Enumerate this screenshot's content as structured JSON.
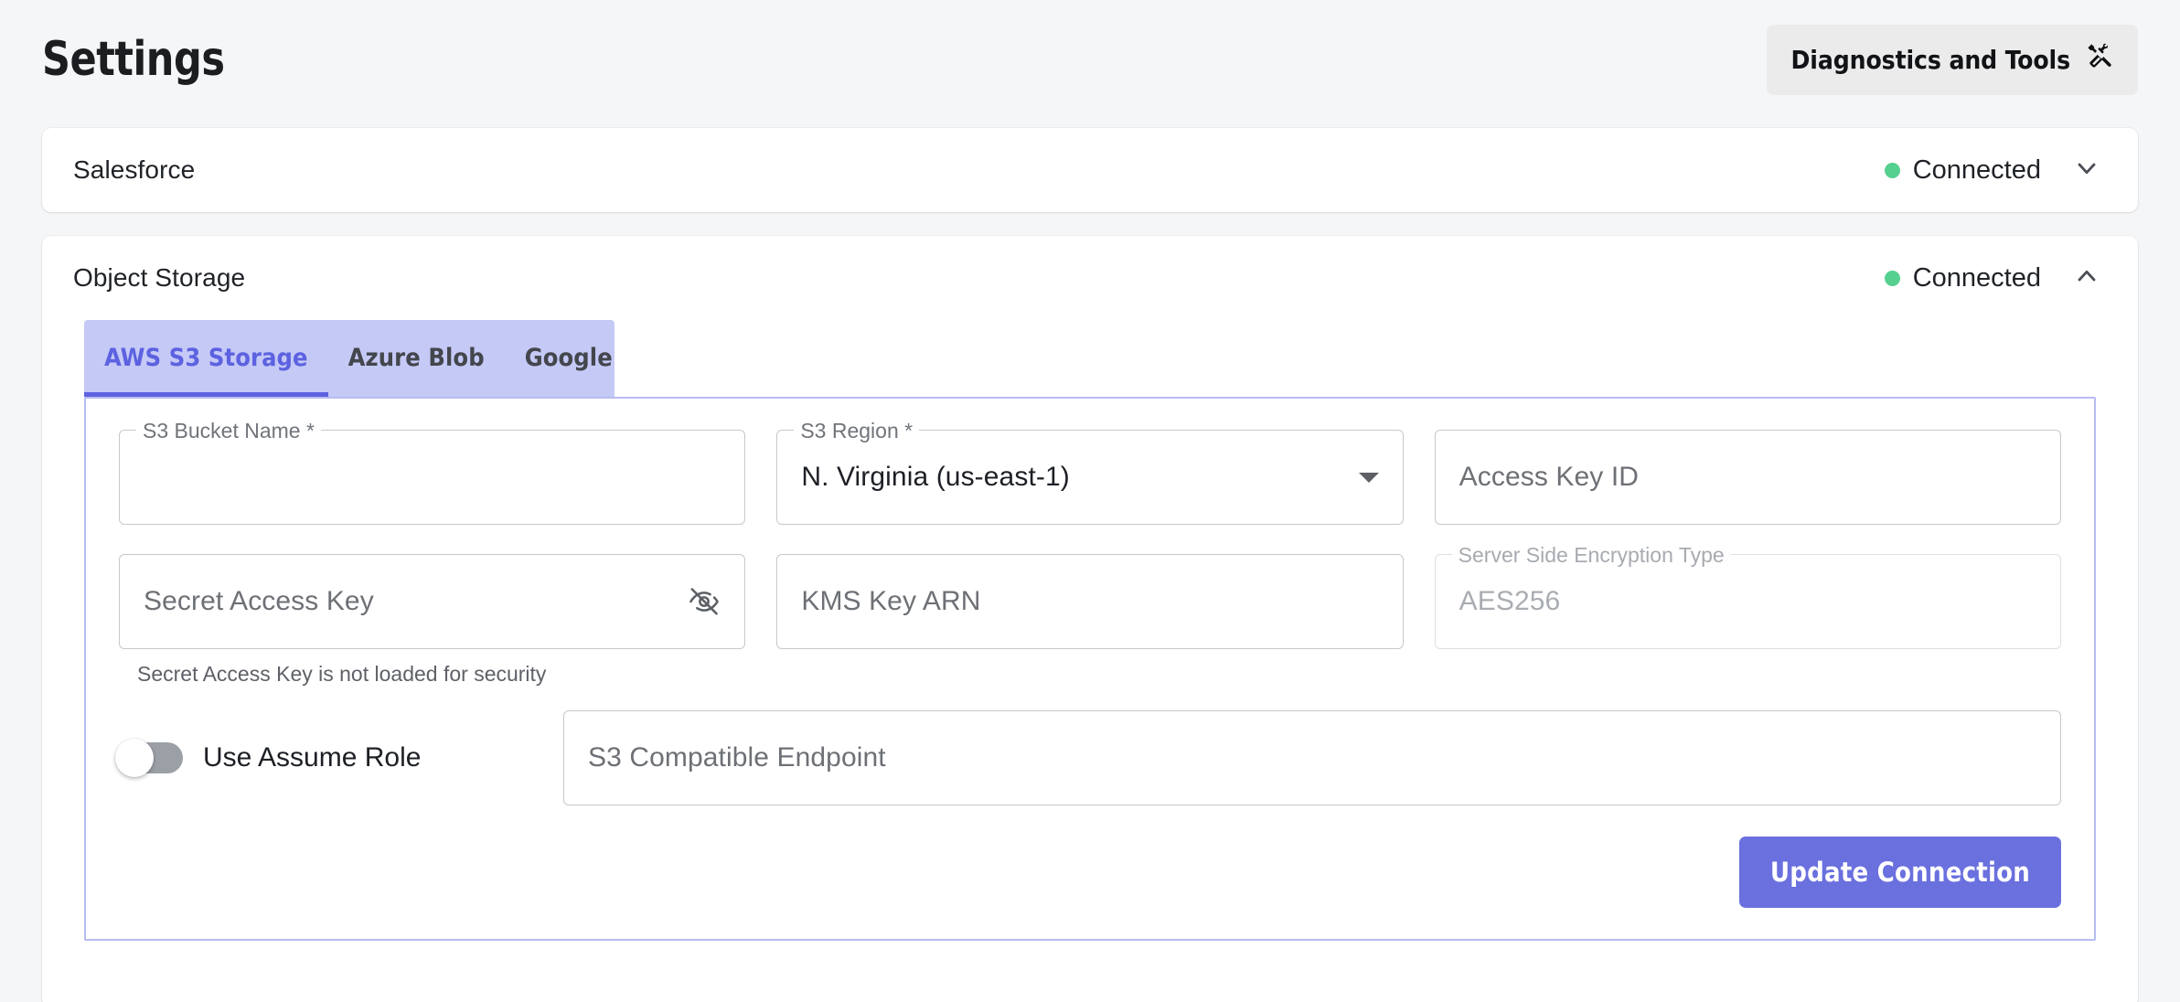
{
  "header": {
    "title": "Settings",
    "diagnostics_button": "Diagnostics and Tools",
    "diagnostics_icon": "tools-icon"
  },
  "colors": {
    "page_background": "#f5f6f7",
    "card_background": "#ffffff",
    "accent_indigo": "#6a70de",
    "tab_bar_background": "#c5c9f6",
    "tab_active_text": "#5c62e0",
    "panel_border": "#b7bcf2",
    "status_connected": "#55d08f",
    "button_gray": "#ebebeb"
  },
  "sections": [
    {
      "name": "salesforce",
      "title": "Salesforce",
      "status_label": "Connected",
      "status_color": "#55d08f",
      "expanded": false,
      "chevron": "chevron-down-icon"
    },
    {
      "name": "object_storage",
      "title": "Object Storage",
      "status_label": "Connected",
      "status_color": "#55d08f",
      "expanded": true,
      "chevron": "chevron-up-icon"
    }
  ],
  "object_storage": {
    "tabs": [
      {
        "label": "AWS S3 Storage",
        "active": true
      },
      {
        "label": "Azure Blob",
        "active": false
      },
      {
        "label": "Google Cloud Platform",
        "active": false
      }
    ],
    "form": {
      "bucket_name": {
        "label": "S3 Bucket Name *",
        "value": "",
        "placeholder": ""
      },
      "region": {
        "label": "S3 Region *",
        "value": "N. Virginia (us-east-1)",
        "icon": "dropdown-arrow-icon"
      },
      "access_key_id": {
        "label": "",
        "value": "",
        "placeholder": "Access Key ID"
      },
      "secret_access_key": {
        "label": "",
        "value": "",
        "placeholder": "Secret Access Key",
        "icon": "visibility-off-icon",
        "helper_text": "Secret Access Key is not loaded for security"
      },
      "kms_key_arn": {
        "label": "",
        "value": "",
        "placeholder": "KMS Key ARN"
      },
      "encryption_type": {
        "label": "Server Side Encryption Type",
        "value": "AES256",
        "disabled": true
      },
      "use_assume_role": {
        "label": "Use Assume Role",
        "enabled": false
      },
      "s3_endpoint": {
        "label": "",
        "value": "",
        "placeholder": "S3 Compatible Endpoint"
      }
    },
    "submit_button": "Update Connection"
  }
}
